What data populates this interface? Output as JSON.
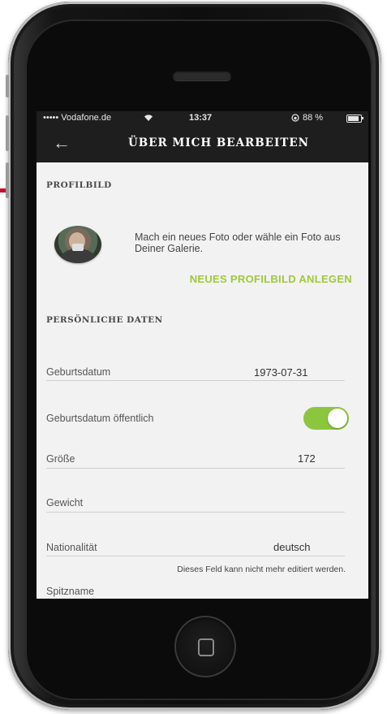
{
  "status_bar": {
    "carrier": "••••• Vodafone.de",
    "wifi_icon": "wifi-icon",
    "time": "13:37",
    "battery": "88 %",
    "battery_level": 0.88
  },
  "header": {
    "back_icon": "arrow-left-icon",
    "title": "ÜBER MICH BEARBEITEN"
  },
  "profile_picture": {
    "section_title": "PROFILBILD",
    "hint": "Mach ein neues Foto oder wähle ein Foto aus Deiner Galerie.",
    "action": "NEUES PROFILBILD ANLEGEN"
  },
  "personal_data": {
    "section_title": "PERSÖNLICHE DATEN",
    "fields": [
      {
        "label": "Geburtsdatum",
        "value": "1973-07-31"
      },
      {
        "label": "Geburtsdatum öffentlich",
        "toggle_on": true
      },
      {
        "label": "Größe",
        "value": "172"
      },
      {
        "label": "Gewicht",
        "value": ""
      },
      {
        "label": "Nationalität",
        "value": "deutsch",
        "note": "Dieses Feld kann nicht mehr editiert werden."
      },
      {
        "label": "Spitzname",
        "value": ""
      }
    ]
  },
  "colors": {
    "accent": "#9cc93c",
    "toggle_on": "#8cc63f",
    "app_bar": "#1e1e1e",
    "marker": "#c8102e"
  }
}
